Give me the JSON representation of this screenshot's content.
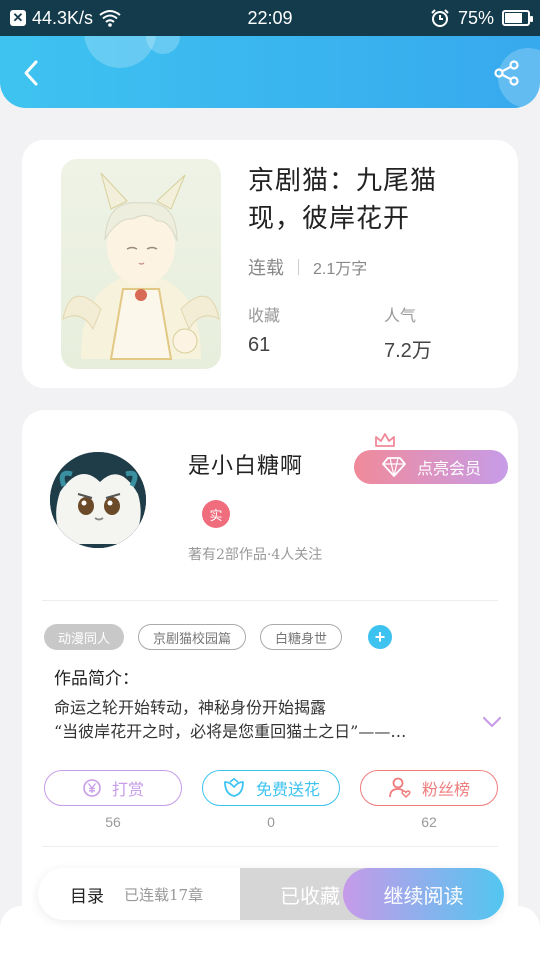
{
  "status_bar": {
    "speed": "44.3K/s",
    "time": "22:09",
    "battery": "75%",
    "battery_level": 0.75
  },
  "header": {
    "back_icon": "chevron-left-icon",
    "share_icon": "share-icon"
  },
  "book": {
    "title_line1": "京剧猫：九尾猫",
    "title_line2": "现，彼岸花开",
    "status": "连载",
    "word_count": "2.1万字",
    "favorites_label": "收藏",
    "favorites_value": "61",
    "popularity_label": "人气",
    "popularity_value": "7.2万"
  },
  "author": {
    "name": "是小白糖啊",
    "vip_button": "点亮会员",
    "real_badge": "实",
    "subtitle": "著有2部作品·4人关注"
  },
  "tags": [
    "动漫同人",
    "京剧猫校园篇",
    "白糖身世"
  ],
  "intro": {
    "title": "作品简介：",
    "line1": "命运之轮开始转动，神秘身份开始揭露",
    "line2": "“当彼岸花开之时，必将是您重回猫土之日”——…"
  },
  "actions": [
    {
      "label": "打赏",
      "count": "56",
      "color": "#c79ce8"
    },
    {
      "label": "免费送花",
      "count": "0",
      "color": "#3ec3f0"
    },
    {
      "label": "粉丝榜",
      "count": "62",
      "color": "#ef7d7d"
    }
  ],
  "bottom": {
    "toc": "目录",
    "chapters": "已连载17章",
    "collected": "已收藏",
    "continue": "继续阅读"
  }
}
